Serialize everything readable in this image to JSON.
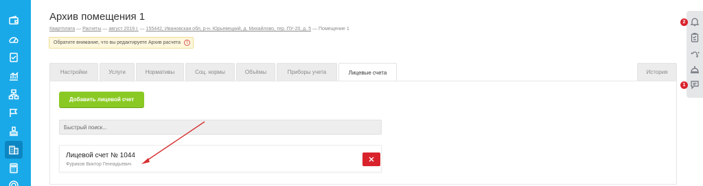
{
  "sidebar": {
    "items": [
      {
        "icon": "wallet-icon"
      },
      {
        "icon": "gauge-icon"
      },
      {
        "icon": "checklist-icon"
      },
      {
        "icon": "stats-chart-icon"
      },
      {
        "icon": "hierarchy-icon"
      },
      {
        "icon": "flag-icon"
      },
      {
        "icon": "stamp-icon"
      },
      {
        "icon": "building-icon",
        "active": true
      },
      {
        "icon": "calculator-icon"
      },
      {
        "icon": "coin-icon"
      }
    ]
  },
  "page": {
    "title": "Архив помещения 1",
    "breadcrumb": [
      {
        "label": "Квартплата",
        "link": true
      },
      {
        "label": "—",
        "link": false
      },
      {
        "label": "Расчеты",
        "link": true
      },
      {
        "label": "—",
        "link": false
      },
      {
        "label": "август 2019 г.",
        "link": true
      },
      {
        "label": "—",
        "link": false
      },
      {
        "label": "155442, Ивановская обл, р-н. Юрьевецкий, д. Михайлово, тер. ПУ-20, д. 5",
        "link": true
      },
      {
        "label": "— Помещение 1",
        "link": false
      }
    ],
    "warning": "Обратите внимание, что вы редактируете Архив расчета",
    "warning_icon_text": "!"
  },
  "tabs": [
    {
      "label": "Настройки",
      "active": false
    },
    {
      "label": "Услуги",
      "active": false
    },
    {
      "label": "Нормативы",
      "active": false
    },
    {
      "label": "Соц. нормы",
      "active": false
    },
    {
      "label": "Объёмы",
      "active": false
    },
    {
      "label": "Приборы учета",
      "active": false
    },
    {
      "label": "Лицевые счета",
      "active": true
    },
    {
      "label": "История",
      "active": false
    }
  ],
  "content": {
    "add_button": "Добавить лицевой счет",
    "search_placeholder": "Быстрый поиск...",
    "account": {
      "title": "Лицевой счет № 1044",
      "owner": "Фуриков Виктор Геннадьевич"
    }
  },
  "rightbar": {
    "items": [
      {
        "icon": "bell-icon",
        "badge": "2"
      },
      {
        "icon": "clipboard-icon"
      },
      {
        "icon": "support-icon"
      },
      {
        "icon": "concierge-icon"
      },
      {
        "icon": "chat-icon",
        "badge": "1"
      }
    ]
  },
  "colors": {
    "sidebar": "#1aa9e8",
    "add_button": "#8ac924",
    "delete_button": "#d9232c",
    "annotation_arrow": "#d62f2f"
  }
}
